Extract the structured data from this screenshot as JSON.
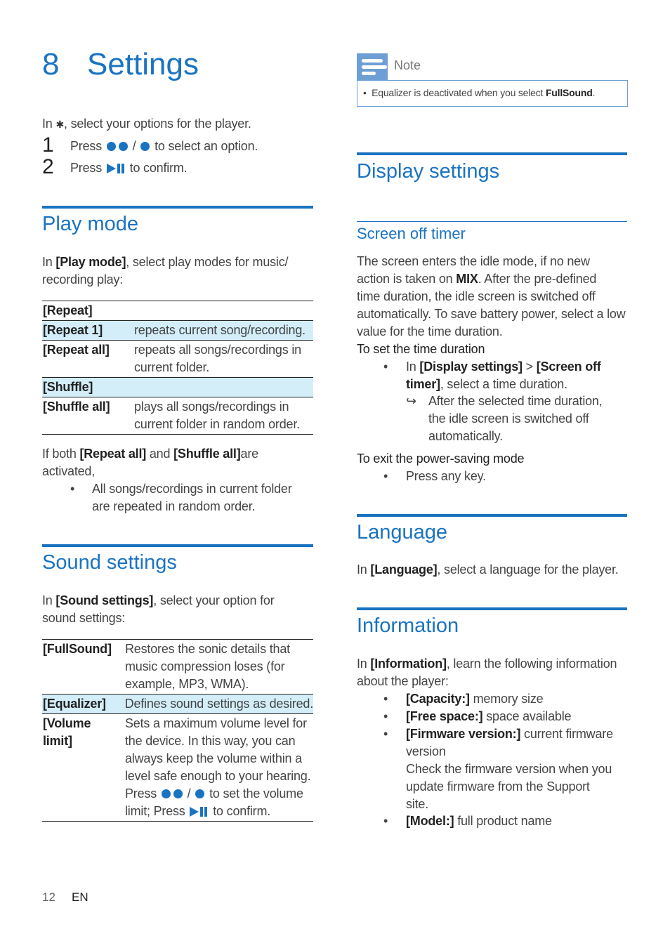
{
  "chapter": {
    "number": "8",
    "title": "Settings"
  },
  "intro": {
    "prefix": "In",
    "icon": "gear-icon",
    "suffix": ", select your options for the player.",
    "steps": [
      {
        "number": "1",
        "before": "Press",
        "between": "/",
        "after": "to select an option."
      },
      {
        "number": "2",
        "before": "Press",
        "after": "to confirm."
      }
    ]
  },
  "play_mode": {
    "title": "Play mode",
    "intro_prefix": "In ",
    "intro_bold": "[Play mode]",
    "intro_line1_rest": ", select play modes for music/",
    "intro_line2": "recording play:",
    "table": [
      {
        "key": "[Repeat]",
        "lines": [],
        "highlight": false
      },
      {
        "key": "[Repeat 1]",
        "lines": [
          "repeats current song/recording."
        ],
        "highlight": true
      },
      {
        "key": "[Repeat all]",
        "lines": [
          "repeats all songs/recordings in",
          "current folder."
        ],
        "highlight": false
      },
      {
        "key": "[Shuffle]",
        "lines": [],
        "highlight": true
      },
      {
        "key": "[Shuffle all]",
        "lines": [
          "plays all songs/recordings in",
          "current folder in random order."
        ],
        "highlight": false
      }
    ],
    "note_prefix": "If both ",
    "note_bold1": "[Repeat all]",
    "note_mid": " and ",
    "note_bold2": "[Shuffle all]",
    "note_end": "are",
    "note_line2": "activated,",
    "bullet_line1": "All songs/recordings in current folder",
    "bullet_line2": "are repeated in random order."
  },
  "sound_settings": {
    "title": "Sound settings",
    "intro_prefix": " In ",
    "intro_bold": "[Sound settings]",
    "intro_line1_rest": ", select your option for",
    "intro_line2": "sound settings:",
    "table": [
      {
        "key": [
          "[FullSound]"
        ],
        "lines": [
          "Restores the sonic details that",
          "music compression loses (for",
          "example, MP3, WMA)."
        ],
        "highlight": false
      },
      {
        "key": [
          "[Equalizer]"
        ],
        "lines": [
          "Defines sound settings as desired."
        ],
        "highlight": true
      },
      {
        "key": [
          "[Volume",
          "limit]"
        ],
        "lines": [
          "Sets a maximum volume level for",
          "the device. In this way, you can",
          "always keep the volume within a",
          "level safe enough to your hearing."
        ],
        "highlight": false
      }
    ],
    "volume_press": "Press",
    "volume_between": "/",
    "volume_after": "to set the volume",
    "volume_line_last_before": "limit; Press",
    "volume_line_last_after": "to confirm."
  },
  "note": {
    "label": "Note",
    "text_prefix": "Equalizer is deactivated when you select ",
    "text_bold": "FullSound",
    "text_end": "."
  },
  "display_settings": {
    "title": "Display settings",
    "subsection": "Screen off timer",
    "body": [
      "The screen enters the idle mode, if no new",
      "action is taken on ",
      "MIX",
      ". After the pre-defined",
      "time duration, the idle screen is switched off",
      "automatically. To save battery power, select a low",
      "value for the time duration."
    ],
    "set_heading": "To set the time duration",
    "set_bullet_prefix": "In ",
    "set_bullet_bold1": "[Display settings]",
    "set_bullet_gt": " > ",
    "set_bullet_bold2": "[Screen off",
    "set_bullet_bold3": "timer]",
    "set_bullet_rest": ", select a time duration.",
    "result_lines": [
      "After the selected time duration,",
      "the idle screen is switched off",
      "automatically."
    ],
    "exit_heading": "To exit the power-saving mode",
    "exit_bullet": "Press any key."
  },
  "language": {
    "title": "Language",
    "prefix": "In ",
    "bold": "[Language]",
    "rest": ", select a language for the player."
  },
  "information": {
    "title": "Information",
    "prefix": "In ",
    "bold": "[Information]",
    "rest": ", learn the following information",
    "line2": "about the player:",
    "items": [
      {
        "key": "[Capacity:]",
        "text": " memory size"
      },
      {
        "key": "[Free space:]",
        "text": " space available"
      },
      {
        "key": "[Firmware version:]",
        "text": " current firmware",
        "extra": [
          "version",
          "Check the firmware version when you",
          "update firmware from the Support",
          "site."
        ]
      },
      {
        "key": "[Model:]",
        "text": " full product name"
      }
    ]
  },
  "footer": {
    "page": "12",
    "lang": "EN"
  },
  "colors": {
    "accent": "#1a73c1",
    "highlight_row": "#d3eef9",
    "note": "#6d9fd4"
  }
}
